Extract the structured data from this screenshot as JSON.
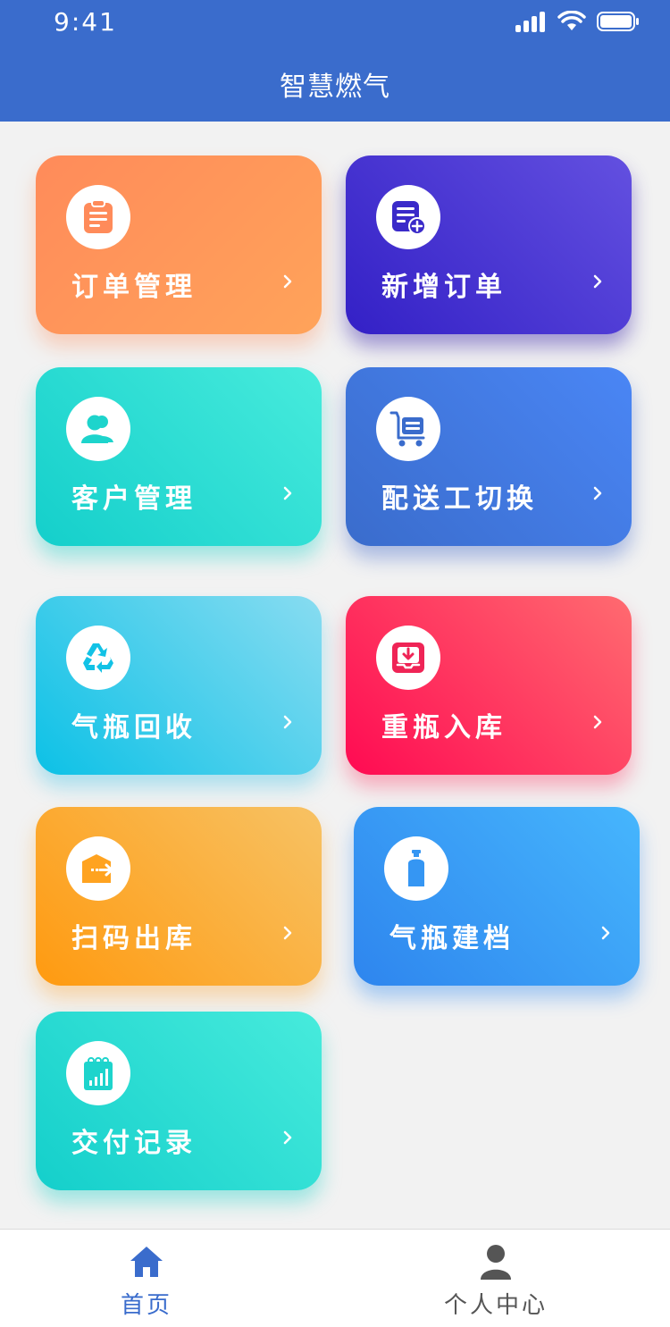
{
  "status_bar": {
    "time": "9:41"
  },
  "header": {
    "title": "智慧燃气"
  },
  "colors": {
    "header_bg": "#3a6ccc",
    "tab_active": "#3a6ccc",
    "tab_inactive": "#555555",
    "page_bg": "#f2f2f2"
  },
  "menu": [
    {
      "label": "订单管理",
      "icon": "clipboard-icon"
    },
    {
      "label": "新增订单",
      "icon": "add-document-icon"
    },
    {
      "label": "客户管理",
      "icon": "users-icon"
    },
    {
      "label": "配送工切换",
      "icon": "delivery-cart-icon"
    },
    {
      "label": "气瓶回收",
      "icon": "recycle-icon"
    },
    {
      "label": "重瓶入库",
      "icon": "inbox-download-icon"
    },
    {
      "label": "扫码出库",
      "icon": "box-out-icon"
    },
    {
      "label": "气瓶建档",
      "icon": "gas-cylinder-icon"
    },
    {
      "label": "交付记录",
      "icon": "report-chart-icon"
    }
  ],
  "tabbar": {
    "home": {
      "label": "首页",
      "icon": "home-icon",
      "active": true
    },
    "profile": {
      "label": "个人中心",
      "icon": "person-icon",
      "active": false
    }
  }
}
